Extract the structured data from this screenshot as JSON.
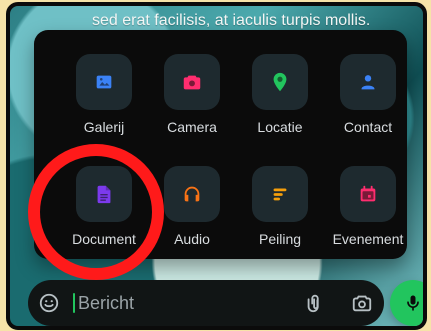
{
  "background_text": "sed erat facilisis, at iaculis turpis mollis.",
  "attach_menu": {
    "items": [
      {
        "label": "Galerij",
        "icon": "gallery-icon",
        "color": "#3b82f6"
      },
      {
        "label": "Camera",
        "icon": "camera-icon",
        "color": "#ff2d6f"
      },
      {
        "label": "Locatie",
        "icon": "location-pin-icon",
        "color": "#22c55e"
      },
      {
        "label": "Contact",
        "icon": "contact-person-icon",
        "color": "#3b82f6"
      },
      {
        "label": "Document",
        "icon": "document-icon",
        "color": "#7c3aed"
      },
      {
        "label": "Audio",
        "icon": "headphones-icon",
        "color": "#f97316"
      },
      {
        "label": "Peiling",
        "icon": "poll-icon",
        "color": "#f59e0b"
      },
      {
        "label": "Evenement",
        "icon": "calendar-icon",
        "color": "#ff2d6f"
      }
    ]
  },
  "composer": {
    "placeholder": "Bericht",
    "icons": {
      "emoji": "emoji-sticker-icon",
      "attach": "paperclip-icon",
      "camera": "camera-icon",
      "mic": "microphone-icon"
    },
    "colors": {
      "mic_bg": "#22c55e",
      "caret": "#22c55e"
    }
  },
  "overlay": {
    "highlight_color": "#ff1a1a"
  }
}
